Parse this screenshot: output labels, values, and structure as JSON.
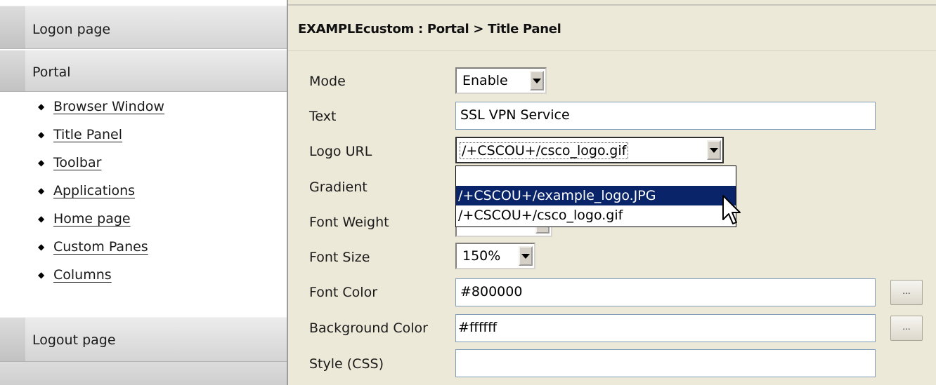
{
  "sidebar": {
    "logon_label": "Logon page",
    "portal_label": "Portal",
    "portal_items": [
      {
        "label": "Browser Window"
      },
      {
        "label": "Title Panel"
      },
      {
        "label": "Toolbar"
      },
      {
        "label": "Applications"
      },
      {
        "label": "Home page"
      },
      {
        "label": "Custom Panes"
      },
      {
        "label": "Columns"
      }
    ],
    "logout_label": "Logout page"
  },
  "main": {
    "title": "EXAMPLEcustom : Portal > Title Panel",
    "form": {
      "mode": {
        "label": "Mode",
        "value": "Enable"
      },
      "text": {
        "label": "Text",
        "value": "SSL VPN Service"
      },
      "logo_url": {
        "label": "Logo URL",
        "value": "/+CSCOU+/csco_logo.gif",
        "options": [
          "",
          "/+CSCOU+/example_logo.JPG",
          "/+CSCOU+/csco_logo.gif"
        ],
        "highlighted": "/+CSCOU+/example_logo.JPG"
      },
      "gradient": {
        "label": "Gradient"
      },
      "font_weight": {
        "label": "Font Weight"
      },
      "font_size": {
        "label": "Font Size",
        "value": "150%"
      },
      "font_color": {
        "label": "Font Color",
        "value": "#800000",
        "button_label": "..."
      },
      "background_color": {
        "label": "Background Color",
        "value": "#ffffff",
        "button_label": "..."
      },
      "style_css": {
        "label": "Style (CSS)",
        "value": ""
      }
    }
  },
  "colors": {
    "panel_background": "#ece9d8",
    "selection": "#0a246a",
    "sidebar_header": "#d4d4d4"
  }
}
